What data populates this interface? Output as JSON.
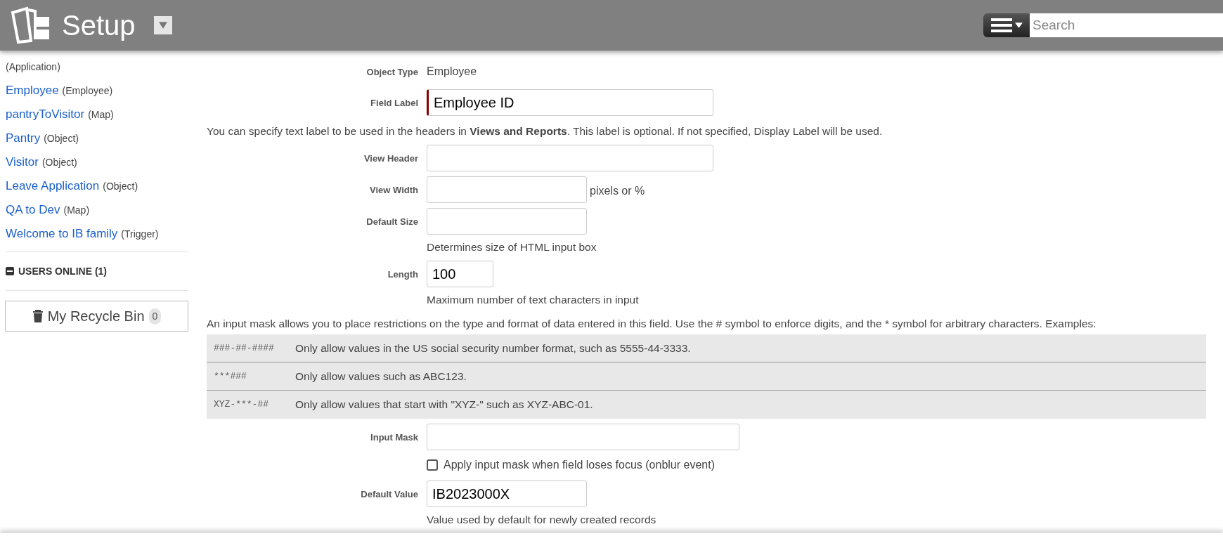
{
  "header": {
    "title": "Setup",
    "search": {
      "placeholder": "Search"
    }
  },
  "sidebar": {
    "items": [
      {
        "type": "(Application)"
      },
      {
        "label": "Employee",
        "type": "(Employee)"
      },
      {
        "label": "pantryToVisitor",
        "type": "(Map)"
      },
      {
        "label": "Pantry",
        "type": "(Object)"
      },
      {
        "label": "Visitor",
        "type": "(Object)"
      },
      {
        "label": "Leave Application",
        "type": "(Object)"
      },
      {
        "label": "QA to Dev",
        "type": "(Map)"
      },
      {
        "label": "Welcome to IB family",
        "type": "(Trigger)"
      }
    ],
    "users_online": {
      "label": "USERS ONLINE (1)",
      "expanded": true
    },
    "recycle_bin": {
      "label": "My Recycle Bin",
      "count": "0"
    }
  },
  "form": [
    {
      "kind": "static",
      "label": "Object Type",
      "value": "Employee"
    },
    {
      "kind": "input",
      "label": "Field Label",
      "value": "Employee ID",
      "required": true
    },
    {
      "kind": "paragraph",
      "text": "You can specify text label to be used in the headers in **Views and Reports**. This label is optional. If not specified, Display Label will be used."
    },
    {
      "kind": "input",
      "label": "View Header",
      "required": false
    },
    {
      "kind": "input",
      "label": "View Width",
      "required": false,
      "suffix": "pixels or %"
    },
    {
      "kind": "input",
      "label": "Default Size",
      "required": false
    },
    {
      "kind": "hint",
      "text": "Determines size of HTML input box"
    },
    {
      "kind": "input",
      "label": "Length",
      "value": "100",
      "required": false
    },
    {
      "kind": "hint",
      "text": "Maximum number of text characters in input"
    },
    {
      "kind": "paragraph",
      "text": "An input mask allows you to place restrictions on the type and format of data entered in this field. Use the # symbol to enforce digits, and the * symbol for arbitrary characters. Examples:"
    },
    {
      "kind": "mask_table",
      "rows": [
        {
          "mask": "###-##-####",
          "description": "Only allow values in the US social security number format, such as 5555-44-3333."
        },
        {
          "mask": "***###",
          "description": "Only allow values such as ABC123."
        },
        {
          "mask": "XYZ-***-##",
          "description": "Only allow values that start with \"XYZ-\" such as XYZ-ABC-01."
        }
      ]
    },
    {
      "kind": "input",
      "label": "Input Mask",
      "required": false
    },
    {
      "kind": "checkbox",
      "label": "Apply input mask when field loses focus (onblur event)",
      "checked": false
    },
    {
      "kind": "input",
      "label": "Default Value",
      "value": "IB2023000X",
      "required": false
    },
    {
      "kind": "hint",
      "text": "Value used by default for newly created records"
    }
  ]
}
